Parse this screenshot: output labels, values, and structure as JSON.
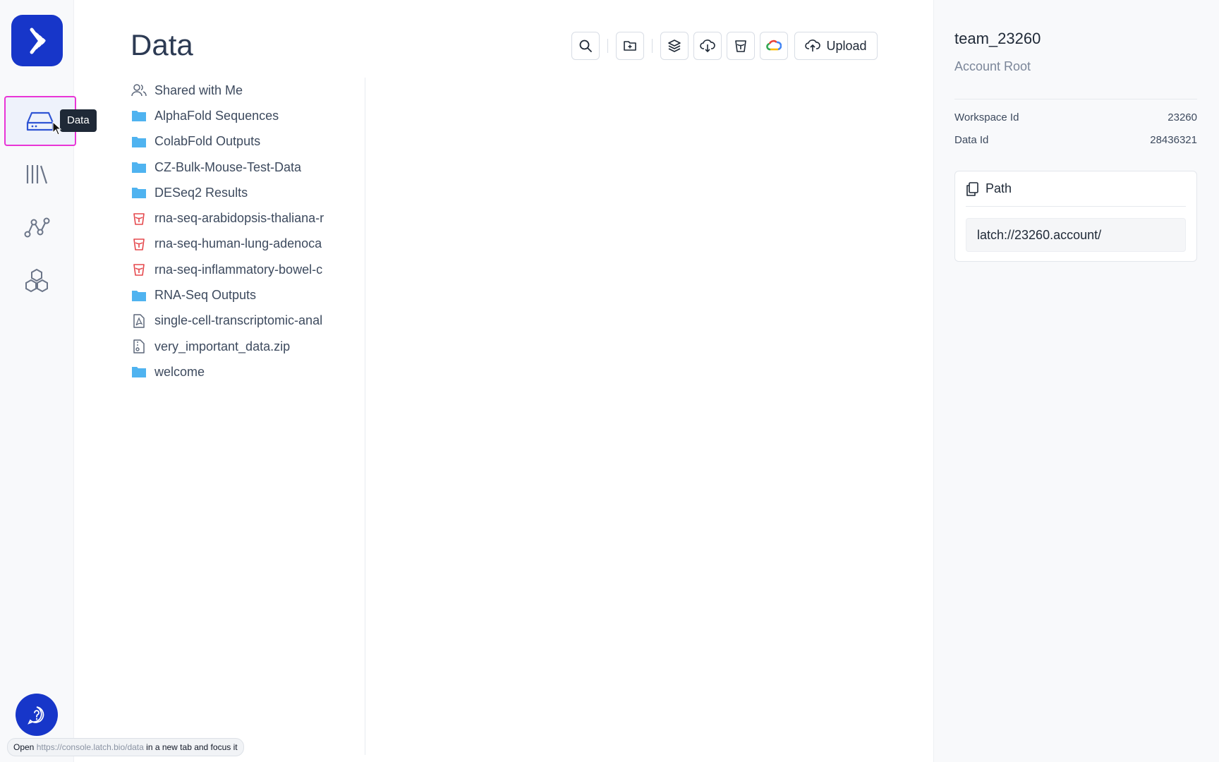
{
  "page": {
    "title": "Data"
  },
  "rail": {
    "items": [
      {
        "name": "data",
        "icon": "hard-drive-icon",
        "active": true
      },
      {
        "name": "library",
        "icon": "library-icon"
      },
      {
        "name": "workflows",
        "icon": "graph-nodes-icon"
      },
      {
        "name": "registry",
        "icon": "hexagons-icon"
      }
    ],
    "tooltip": "Data"
  },
  "toolbar": {
    "upload_label": "Upload",
    "buttons": [
      "search-icon",
      "new-folder-icon",
      "layers-icon",
      "cloud-download-icon",
      "bucket-icon",
      "google-cloud-icon"
    ]
  },
  "files": [
    {
      "label": "Shared with Me",
      "icon": "users-icon"
    },
    {
      "label": "AlphaFold Sequences",
      "icon": "folder-icon"
    },
    {
      "label": "ColabFold Outputs",
      "icon": "folder-icon"
    },
    {
      "label": "CZ-Bulk-Mouse-Test-Data",
      "icon": "folder-icon"
    },
    {
      "label": "DESeq2 Results",
      "icon": "folder-icon"
    },
    {
      "label": "rna-seq-arabidopsis-thaliana-r",
      "icon": "bucket-icon"
    },
    {
      "label": "rna-seq-human-lung-adenoca",
      "icon": "bucket-icon"
    },
    {
      "label": "rna-seq-inflammatory-bowel-c",
      "icon": "bucket-icon"
    },
    {
      "label": "RNA-Seq Outputs",
      "icon": "folder-icon"
    },
    {
      "label": "single-cell-transcriptomic-anal",
      "icon": "pdf-file-icon"
    },
    {
      "label": "very_important_data.zip",
      "icon": "zip-file-icon"
    },
    {
      "label": "welcome",
      "icon": "folder-icon"
    }
  ],
  "details": {
    "name": "team_23260",
    "subtitle": "Account Root",
    "workspace_id_label": "Workspace Id",
    "workspace_id": "23260",
    "data_id_label": "Data Id",
    "data_id": "28436321",
    "path_label": "Path",
    "path_value": "latch://23260.account/"
  },
  "status_bar": {
    "prefix": "Open",
    "url": "https://console.latch.bio/data",
    "suffix": "in a new tab and focus it"
  },
  "colors": {
    "brand": "#1736c9",
    "folder": "#4fb3f0",
    "bucket": "#e5484d",
    "highlight": "#e935d6"
  }
}
